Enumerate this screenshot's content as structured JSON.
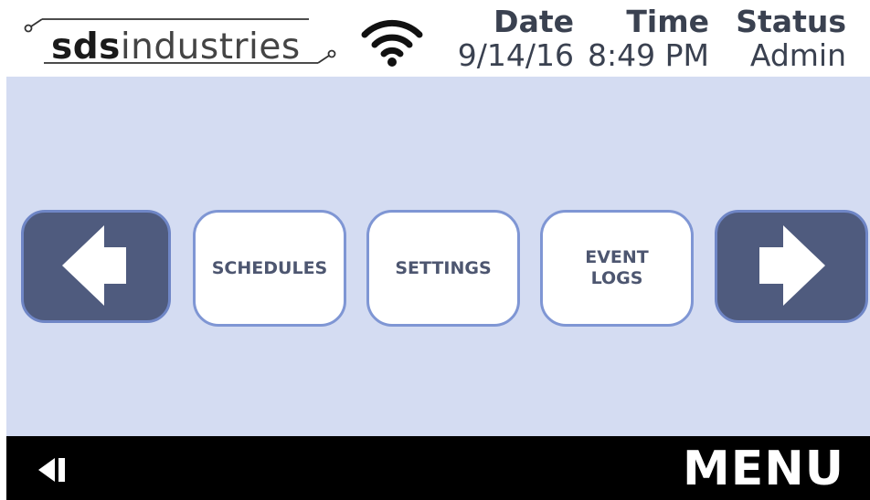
{
  "header": {
    "logo": {
      "bold": "sds",
      "light": "industries"
    },
    "wifi_icon": "wifi-icon",
    "date": {
      "label": "Date",
      "value": "9/14/16"
    },
    "time": {
      "label": "Time",
      "value": "8:49 PM"
    },
    "status": {
      "label": "Status",
      "value": "Admin"
    }
  },
  "nav": {
    "prev_icon": "arrow-left-icon",
    "next_icon": "arrow-right-icon"
  },
  "menu_items": [
    {
      "lines": [
        "SCHEDULES"
      ]
    },
    {
      "lines": [
        "SETTINGS"
      ]
    },
    {
      "lines": [
        "EVENT",
        "LOGS"
      ]
    }
  ],
  "footer": {
    "back_icon": "back-arrow-icon",
    "title": "MENU"
  },
  "colors": {
    "background": "#d4dcf2",
    "nav_button": "#4f5b7e",
    "button_border": "#7f96d4",
    "footer": "#000000"
  }
}
